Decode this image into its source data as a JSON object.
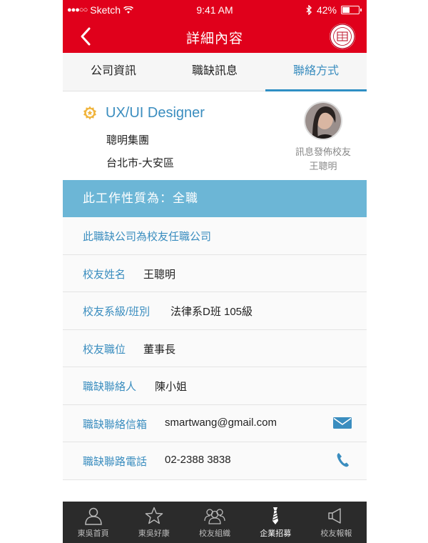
{
  "status_bar": {
    "carrier": "Sketch",
    "time": "9:41 AM",
    "battery": "42%"
  },
  "header": {
    "title": "詳細內容"
  },
  "tabs": [
    {
      "label": "公司資訊",
      "active": false
    },
    {
      "label": "職缺訊息",
      "active": false
    },
    {
      "label": "聯絡方式",
      "active": true
    }
  ],
  "job": {
    "title": "UX/UI Designer",
    "company": "聰明集團",
    "location": "台北市-大安區",
    "poster_label": "訊息發佈校友",
    "poster_name": "王聰明"
  },
  "banner": {
    "text": "此工作性質為：全職"
  },
  "rows": [
    {
      "label": "此職缺公司為校友任職公司",
      "value": ""
    },
    {
      "label": "校友姓名",
      "value": "王聰明"
    },
    {
      "label": "校友系級/班別",
      "value": "法律系D班 105級"
    },
    {
      "label": "校友職位",
      "value": "董事長"
    },
    {
      "label": "職缺聯絡人",
      "value": "陳小姐"
    },
    {
      "label": "職缺聯絡信箱",
      "value": "smartwang@gmail.com",
      "icon": "mail-icon"
    },
    {
      "label": "職缺聯路電話",
      "value": "02-2388 3838",
      "icon": "phone-icon"
    }
  ],
  "tabbar": [
    {
      "label": "東吳首頁",
      "icon": "person-icon",
      "active": false
    },
    {
      "label": "東吳好康",
      "icon": "star-icon",
      "active": false
    },
    {
      "label": "校友組織",
      "icon": "group-icon",
      "active": false
    },
    {
      "label": "企業招募",
      "icon": "tie-icon",
      "active": true
    },
    {
      "label": "校友報報",
      "icon": "megaphone-icon",
      "active": false
    }
  ],
  "colors": {
    "header_red": "#e0001b",
    "accent_blue": "#3a8dbf",
    "banner_blue": "#6cb6d6",
    "tabbar_dark": "#2b2b2b"
  }
}
